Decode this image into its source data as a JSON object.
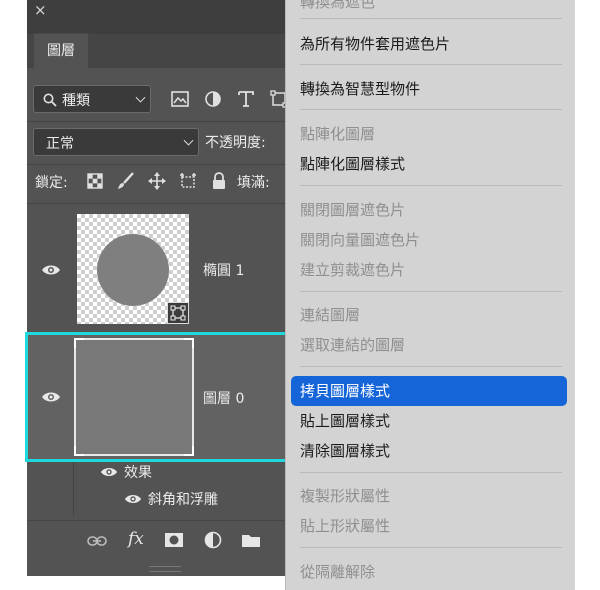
{
  "panel": {
    "close_glyph": "×",
    "tab_label": "圖層",
    "filter": {
      "kind_label": "種類"
    },
    "blend_mode": "正常",
    "opacity_label": "不透明度:",
    "lock_label": "鎖定:",
    "fill_label": "填滿:",
    "layers": [
      {
        "name": "橢圓 1",
        "visible": true,
        "selected": false
      },
      {
        "name": "圖層 0",
        "visible": true,
        "selected": true
      }
    ],
    "effects_label": "效果",
    "effect_item": "斜角和浮雕",
    "footer_icons": [
      "link-icon",
      "fx-icon",
      "mask-icon",
      "adjustment-icon",
      "folder-icon"
    ],
    "fx_label": "fx"
  },
  "menu": {
    "items": [
      {
        "label": "轉換為遮色",
        "enabled": false
      },
      {
        "label": "為所有物件套用遮色片",
        "enabled": true
      },
      {
        "label": "轉換為智慧型物件",
        "enabled": true
      },
      {
        "label": "點陣化圖層",
        "enabled": false
      },
      {
        "label": "點陣化圖層樣式",
        "enabled": true
      },
      {
        "label": "關閉圖層遮色片",
        "enabled": false
      },
      {
        "label": "關閉向量圖遮色片",
        "enabled": false
      },
      {
        "label": "建立剪裁遮色片",
        "enabled": false
      },
      {
        "label": "連結圖層",
        "enabled": false
      },
      {
        "label": "選取連結的圖層",
        "enabled": false
      },
      {
        "label": "拷貝圖層樣式",
        "enabled": true,
        "highlighted": true
      },
      {
        "label": "貼上圖層樣式",
        "enabled": true
      },
      {
        "label": "清除圖層樣式",
        "enabled": true
      },
      {
        "label": "複製形狀屬性",
        "enabled": false
      },
      {
        "label": "貼上形狀屬性",
        "enabled": false
      },
      {
        "label": "從隔離解除",
        "enabled": false
      }
    ],
    "highlight_color": "#1565d8"
  },
  "colors": {
    "panel_bg": "#535353",
    "selection_outline": "#1fd8dd",
    "menu_bg": "#d3d3d3"
  }
}
